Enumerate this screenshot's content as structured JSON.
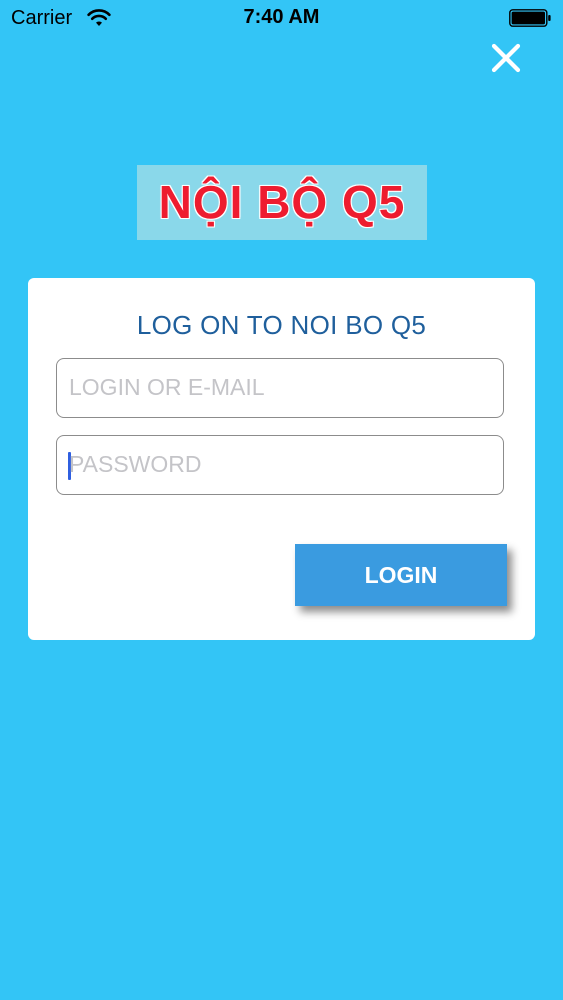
{
  "status_bar": {
    "carrier": "Carrier",
    "time": "7:40 AM"
  },
  "header": {
    "logo_text": "NỘI BỘ Q5"
  },
  "login_card": {
    "title": "LOG ON TO NOI BO Q5",
    "login_field": {
      "placeholder": "LOGIN OR E-MAIL",
      "value": ""
    },
    "password_field": {
      "placeholder": "PASSWORD",
      "value": ""
    },
    "login_button_label": "LOGIN"
  },
  "colors": {
    "background": "#33c5f6",
    "logo_box": "#8ad8ea",
    "logo_text": "#ee1c2f",
    "card": "#ffffff",
    "title_text": "#1f5f9c",
    "button": "#3a9be0"
  },
  "icons": {
    "wifi": "wifi-icon",
    "battery": "battery-icon",
    "close": "close-icon"
  }
}
